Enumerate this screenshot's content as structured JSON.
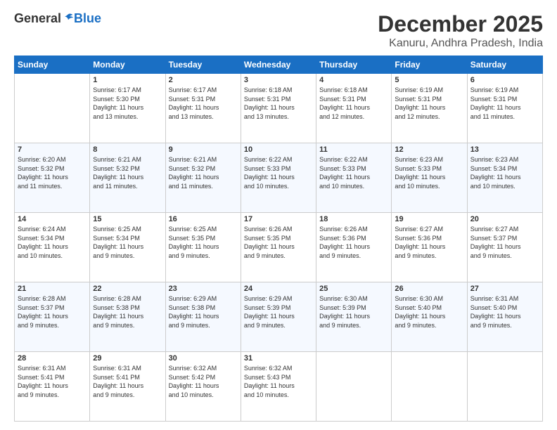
{
  "header": {
    "logo_general": "General",
    "logo_blue": "Blue",
    "month_year": "December 2025",
    "location": "Kanuru, Andhra Pradesh, India"
  },
  "weekdays": [
    "Sunday",
    "Monday",
    "Tuesday",
    "Wednesday",
    "Thursday",
    "Friday",
    "Saturday"
  ],
  "weeks": [
    [
      {
        "day": "",
        "info": ""
      },
      {
        "day": "1",
        "info": "Sunrise: 6:17 AM\nSunset: 5:30 PM\nDaylight: 11 hours\nand 13 minutes."
      },
      {
        "day": "2",
        "info": "Sunrise: 6:17 AM\nSunset: 5:31 PM\nDaylight: 11 hours\nand 13 minutes."
      },
      {
        "day": "3",
        "info": "Sunrise: 6:18 AM\nSunset: 5:31 PM\nDaylight: 11 hours\nand 13 minutes."
      },
      {
        "day": "4",
        "info": "Sunrise: 6:18 AM\nSunset: 5:31 PM\nDaylight: 11 hours\nand 12 minutes."
      },
      {
        "day": "5",
        "info": "Sunrise: 6:19 AM\nSunset: 5:31 PM\nDaylight: 11 hours\nand 12 minutes."
      },
      {
        "day": "6",
        "info": "Sunrise: 6:19 AM\nSunset: 5:31 PM\nDaylight: 11 hours\nand 11 minutes."
      }
    ],
    [
      {
        "day": "7",
        "info": "Sunrise: 6:20 AM\nSunset: 5:32 PM\nDaylight: 11 hours\nand 11 minutes."
      },
      {
        "day": "8",
        "info": "Sunrise: 6:21 AM\nSunset: 5:32 PM\nDaylight: 11 hours\nand 11 minutes."
      },
      {
        "day": "9",
        "info": "Sunrise: 6:21 AM\nSunset: 5:32 PM\nDaylight: 11 hours\nand 11 minutes."
      },
      {
        "day": "10",
        "info": "Sunrise: 6:22 AM\nSunset: 5:33 PM\nDaylight: 11 hours\nand 10 minutes."
      },
      {
        "day": "11",
        "info": "Sunrise: 6:22 AM\nSunset: 5:33 PM\nDaylight: 11 hours\nand 10 minutes."
      },
      {
        "day": "12",
        "info": "Sunrise: 6:23 AM\nSunset: 5:33 PM\nDaylight: 11 hours\nand 10 minutes."
      },
      {
        "day": "13",
        "info": "Sunrise: 6:23 AM\nSunset: 5:34 PM\nDaylight: 11 hours\nand 10 minutes."
      }
    ],
    [
      {
        "day": "14",
        "info": "Sunrise: 6:24 AM\nSunset: 5:34 PM\nDaylight: 11 hours\nand 10 minutes."
      },
      {
        "day": "15",
        "info": "Sunrise: 6:25 AM\nSunset: 5:34 PM\nDaylight: 11 hours\nand 9 minutes."
      },
      {
        "day": "16",
        "info": "Sunrise: 6:25 AM\nSunset: 5:35 PM\nDaylight: 11 hours\nand 9 minutes."
      },
      {
        "day": "17",
        "info": "Sunrise: 6:26 AM\nSunset: 5:35 PM\nDaylight: 11 hours\nand 9 minutes."
      },
      {
        "day": "18",
        "info": "Sunrise: 6:26 AM\nSunset: 5:36 PM\nDaylight: 11 hours\nand 9 minutes."
      },
      {
        "day": "19",
        "info": "Sunrise: 6:27 AM\nSunset: 5:36 PM\nDaylight: 11 hours\nand 9 minutes."
      },
      {
        "day": "20",
        "info": "Sunrise: 6:27 AM\nSunset: 5:37 PM\nDaylight: 11 hours\nand 9 minutes."
      }
    ],
    [
      {
        "day": "21",
        "info": "Sunrise: 6:28 AM\nSunset: 5:37 PM\nDaylight: 11 hours\nand 9 minutes."
      },
      {
        "day": "22",
        "info": "Sunrise: 6:28 AM\nSunset: 5:38 PM\nDaylight: 11 hours\nand 9 minutes."
      },
      {
        "day": "23",
        "info": "Sunrise: 6:29 AM\nSunset: 5:38 PM\nDaylight: 11 hours\nand 9 minutes."
      },
      {
        "day": "24",
        "info": "Sunrise: 6:29 AM\nSunset: 5:39 PM\nDaylight: 11 hours\nand 9 minutes."
      },
      {
        "day": "25",
        "info": "Sunrise: 6:30 AM\nSunset: 5:39 PM\nDaylight: 11 hours\nand 9 minutes."
      },
      {
        "day": "26",
        "info": "Sunrise: 6:30 AM\nSunset: 5:40 PM\nDaylight: 11 hours\nand 9 minutes."
      },
      {
        "day": "27",
        "info": "Sunrise: 6:31 AM\nSunset: 5:40 PM\nDaylight: 11 hours\nand 9 minutes."
      }
    ],
    [
      {
        "day": "28",
        "info": "Sunrise: 6:31 AM\nSunset: 5:41 PM\nDaylight: 11 hours\nand 9 minutes."
      },
      {
        "day": "29",
        "info": "Sunrise: 6:31 AM\nSunset: 5:41 PM\nDaylight: 11 hours\nand 9 minutes."
      },
      {
        "day": "30",
        "info": "Sunrise: 6:32 AM\nSunset: 5:42 PM\nDaylight: 11 hours\nand 10 minutes."
      },
      {
        "day": "31",
        "info": "Sunrise: 6:32 AM\nSunset: 5:43 PM\nDaylight: 11 hours\nand 10 minutes."
      },
      {
        "day": "",
        "info": ""
      },
      {
        "day": "",
        "info": ""
      },
      {
        "day": "",
        "info": ""
      }
    ]
  ]
}
